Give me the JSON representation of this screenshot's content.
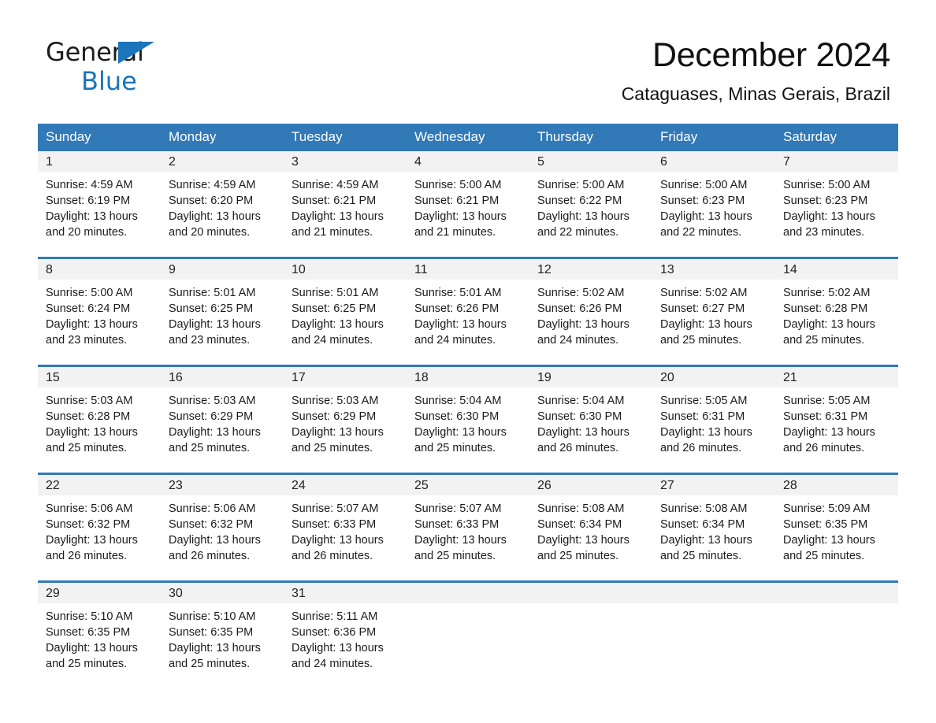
{
  "logo": {
    "word_top": "General",
    "word_bottom": "Blue",
    "triangle_color": "#1a75bb",
    "text_color": "#1c1c1c"
  },
  "header": {
    "title": "December 2024",
    "subtitle": "Cataguases, Minas Gerais, Brazil"
  },
  "theme": {
    "header_blue": "#3179b7",
    "row_rule_blue": "#3179b7",
    "daynum_band": "#f2f2f2",
    "page_background": "#ffffff",
    "body_text": "#1b1b1b"
  },
  "weekday_headers": [
    "Sunday",
    "Monday",
    "Tuesday",
    "Wednesday",
    "Thursday",
    "Friday",
    "Saturday"
  ],
  "labels": {
    "sunrise_prefix": "Sunrise:",
    "sunset_prefix": "Sunset:",
    "daylight_prefix": "Daylight:"
  },
  "weeks": [
    [
      {
        "day": "1",
        "sunrise": "Sunrise: 4:59 AM",
        "sunset": "Sunset: 6:19 PM",
        "daylight_l1": "Daylight: 13 hours",
        "daylight_l2": "and 20 minutes."
      },
      {
        "day": "2",
        "sunrise": "Sunrise: 4:59 AM",
        "sunset": "Sunset: 6:20 PM",
        "daylight_l1": "Daylight: 13 hours",
        "daylight_l2": "and 20 minutes."
      },
      {
        "day": "3",
        "sunrise": "Sunrise: 4:59 AM",
        "sunset": "Sunset: 6:21 PM",
        "daylight_l1": "Daylight: 13 hours",
        "daylight_l2": "and 21 minutes."
      },
      {
        "day": "4",
        "sunrise": "Sunrise: 5:00 AM",
        "sunset": "Sunset: 6:21 PM",
        "daylight_l1": "Daylight: 13 hours",
        "daylight_l2": "and 21 minutes."
      },
      {
        "day": "5",
        "sunrise": "Sunrise: 5:00 AM",
        "sunset": "Sunset: 6:22 PM",
        "daylight_l1": "Daylight: 13 hours",
        "daylight_l2": "and 22 minutes."
      },
      {
        "day": "6",
        "sunrise": "Sunrise: 5:00 AM",
        "sunset": "Sunset: 6:23 PM",
        "daylight_l1": "Daylight: 13 hours",
        "daylight_l2": "and 22 minutes."
      },
      {
        "day": "7",
        "sunrise": "Sunrise: 5:00 AM",
        "sunset": "Sunset: 6:23 PM",
        "daylight_l1": "Daylight: 13 hours",
        "daylight_l2": "and 23 minutes."
      }
    ],
    [
      {
        "day": "8",
        "sunrise": "Sunrise: 5:00 AM",
        "sunset": "Sunset: 6:24 PM",
        "daylight_l1": "Daylight: 13 hours",
        "daylight_l2": "and 23 minutes."
      },
      {
        "day": "9",
        "sunrise": "Sunrise: 5:01 AM",
        "sunset": "Sunset: 6:25 PM",
        "daylight_l1": "Daylight: 13 hours",
        "daylight_l2": "and 23 minutes."
      },
      {
        "day": "10",
        "sunrise": "Sunrise: 5:01 AM",
        "sunset": "Sunset: 6:25 PM",
        "daylight_l1": "Daylight: 13 hours",
        "daylight_l2": "and 24 minutes."
      },
      {
        "day": "11",
        "sunrise": "Sunrise: 5:01 AM",
        "sunset": "Sunset: 6:26 PM",
        "daylight_l1": "Daylight: 13 hours",
        "daylight_l2": "and 24 minutes."
      },
      {
        "day": "12",
        "sunrise": "Sunrise: 5:02 AM",
        "sunset": "Sunset: 6:26 PM",
        "daylight_l1": "Daylight: 13 hours",
        "daylight_l2": "and 24 minutes."
      },
      {
        "day": "13",
        "sunrise": "Sunrise: 5:02 AM",
        "sunset": "Sunset: 6:27 PM",
        "daylight_l1": "Daylight: 13 hours",
        "daylight_l2": "and 25 minutes."
      },
      {
        "day": "14",
        "sunrise": "Sunrise: 5:02 AM",
        "sunset": "Sunset: 6:28 PM",
        "daylight_l1": "Daylight: 13 hours",
        "daylight_l2": "and 25 minutes."
      }
    ],
    [
      {
        "day": "15",
        "sunrise": "Sunrise: 5:03 AM",
        "sunset": "Sunset: 6:28 PM",
        "daylight_l1": "Daylight: 13 hours",
        "daylight_l2": "and 25 minutes."
      },
      {
        "day": "16",
        "sunrise": "Sunrise: 5:03 AM",
        "sunset": "Sunset: 6:29 PM",
        "daylight_l1": "Daylight: 13 hours",
        "daylight_l2": "and 25 minutes."
      },
      {
        "day": "17",
        "sunrise": "Sunrise: 5:03 AM",
        "sunset": "Sunset: 6:29 PM",
        "daylight_l1": "Daylight: 13 hours",
        "daylight_l2": "and 25 minutes."
      },
      {
        "day": "18",
        "sunrise": "Sunrise: 5:04 AM",
        "sunset": "Sunset: 6:30 PM",
        "daylight_l1": "Daylight: 13 hours",
        "daylight_l2": "and 25 minutes."
      },
      {
        "day": "19",
        "sunrise": "Sunrise: 5:04 AM",
        "sunset": "Sunset: 6:30 PM",
        "daylight_l1": "Daylight: 13 hours",
        "daylight_l2": "and 26 minutes."
      },
      {
        "day": "20",
        "sunrise": "Sunrise: 5:05 AM",
        "sunset": "Sunset: 6:31 PM",
        "daylight_l1": "Daylight: 13 hours",
        "daylight_l2": "and 26 minutes."
      },
      {
        "day": "21",
        "sunrise": "Sunrise: 5:05 AM",
        "sunset": "Sunset: 6:31 PM",
        "daylight_l1": "Daylight: 13 hours",
        "daylight_l2": "and 26 minutes."
      }
    ],
    [
      {
        "day": "22",
        "sunrise": "Sunrise: 5:06 AM",
        "sunset": "Sunset: 6:32 PM",
        "daylight_l1": "Daylight: 13 hours",
        "daylight_l2": "and 26 minutes."
      },
      {
        "day": "23",
        "sunrise": "Sunrise: 5:06 AM",
        "sunset": "Sunset: 6:32 PM",
        "daylight_l1": "Daylight: 13 hours",
        "daylight_l2": "and 26 minutes."
      },
      {
        "day": "24",
        "sunrise": "Sunrise: 5:07 AM",
        "sunset": "Sunset: 6:33 PM",
        "daylight_l1": "Daylight: 13 hours",
        "daylight_l2": "and 26 minutes."
      },
      {
        "day": "25",
        "sunrise": "Sunrise: 5:07 AM",
        "sunset": "Sunset: 6:33 PM",
        "daylight_l1": "Daylight: 13 hours",
        "daylight_l2": "and 25 minutes."
      },
      {
        "day": "26",
        "sunrise": "Sunrise: 5:08 AM",
        "sunset": "Sunset: 6:34 PM",
        "daylight_l1": "Daylight: 13 hours",
        "daylight_l2": "and 25 minutes."
      },
      {
        "day": "27",
        "sunrise": "Sunrise: 5:08 AM",
        "sunset": "Sunset: 6:34 PM",
        "daylight_l1": "Daylight: 13 hours",
        "daylight_l2": "and 25 minutes."
      },
      {
        "day": "28",
        "sunrise": "Sunrise: 5:09 AM",
        "sunset": "Sunset: 6:35 PM",
        "daylight_l1": "Daylight: 13 hours",
        "daylight_l2": "and 25 minutes."
      }
    ],
    [
      {
        "day": "29",
        "sunrise": "Sunrise: 5:10 AM",
        "sunset": "Sunset: 6:35 PM",
        "daylight_l1": "Daylight: 13 hours",
        "daylight_l2": "and 25 minutes."
      },
      {
        "day": "30",
        "sunrise": "Sunrise: 5:10 AM",
        "sunset": "Sunset: 6:35 PM",
        "daylight_l1": "Daylight: 13 hours",
        "daylight_l2": "and 25 minutes."
      },
      {
        "day": "31",
        "sunrise": "Sunrise: 5:11 AM",
        "sunset": "Sunset: 6:36 PM",
        "daylight_l1": "Daylight: 13 hours",
        "daylight_l2": "and 24 minutes."
      },
      {
        "day": "",
        "sunrise": "",
        "sunset": "",
        "daylight_l1": "",
        "daylight_l2": ""
      },
      {
        "day": "",
        "sunrise": "",
        "sunset": "",
        "daylight_l1": "",
        "daylight_l2": ""
      },
      {
        "day": "",
        "sunrise": "",
        "sunset": "",
        "daylight_l1": "",
        "daylight_l2": ""
      },
      {
        "day": "",
        "sunrise": "",
        "sunset": "",
        "daylight_l1": "",
        "daylight_l2": ""
      }
    ]
  ]
}
